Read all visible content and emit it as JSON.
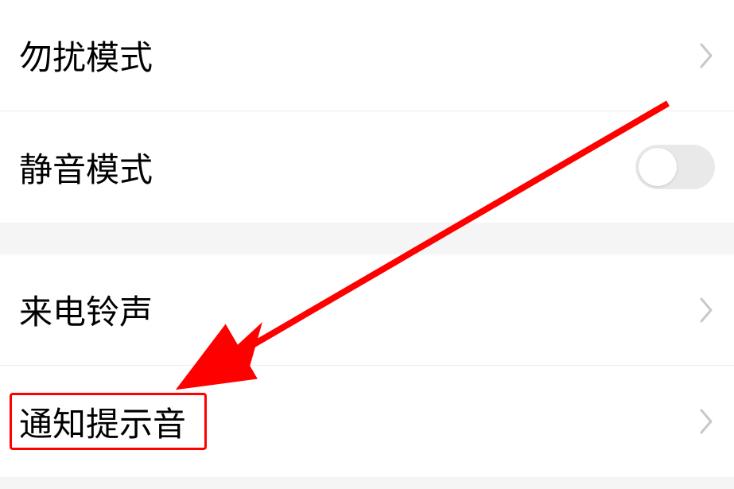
{
  "rows": {
    "dnd": {
      "label": "勿扰模式"
    },
    "silent": {
      "label": "静音模式",
      "toggle_on": false
    },
    "ringtone": {
      "label": "来电铃声"
    },
    "notification_sound": {
      "label": "通知提示音"
    }
  },
  "annotation": {
    "arrow_color": "#ff0000",
    "highlight_color": "#ff0000"
  }
}
